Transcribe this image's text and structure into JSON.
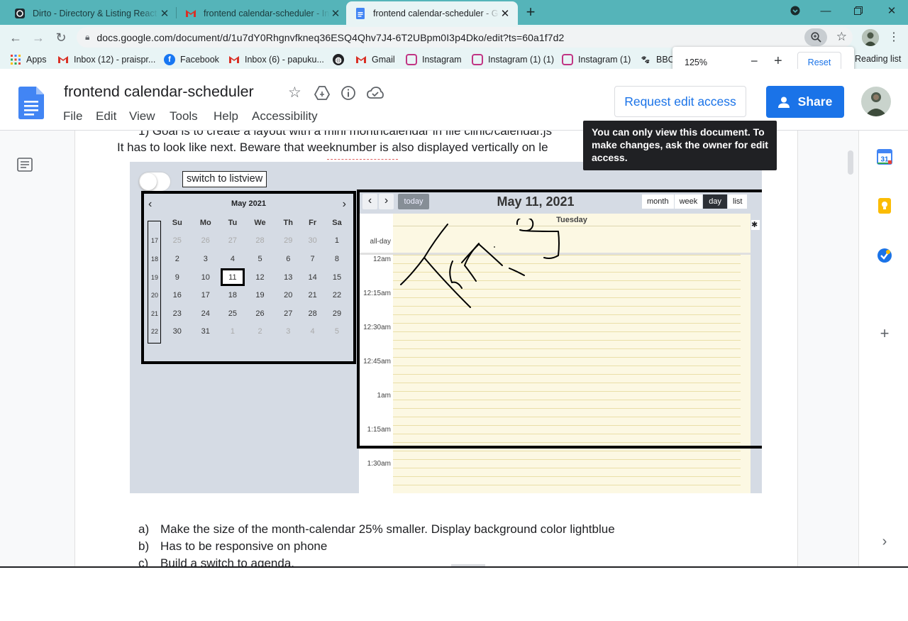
{
  "browser": {
    "tabs": [
      {
        "title": "Dirto - Directory & Listing React",
        "icon": "dirto-favicon"
      },
      {
        "title": "frontend calendar-scheduler - Inb",
        "icon": "gmail-icon"
      },
      {
        "title": "frontend calendar-scheduler - Go",
        "icon": "google-docs-icon",
        "active": true
      }
    ],
    "new_tab": "+",
    "url": "docs.google.com/document/d/1u7dY0Rhgnvfkneq36ESQ4Qhv7J4-6T2UBpm0I3p4Dko/edit?ts=60a1f7d2",
    "bookmarks": [
      {
        "label": "Apps",
        "icon": "apps-grid-icon"
      },
      {
        "label": "Inbox (12) - praispr...",
        "icon": "gmail-icon"
      },
      {
        "label": "Facebook",
        "icon": "facebook-icon"
      },
      {
        "label": "Inbox (6) - papuku...",
        "icon": "gmail-icon"
      },
      {
        "label": "",
        "icon": "globe-icon"
      },
      {
        "label": "Gmail",
        "icon": "gmail-icon"
      },
      {
        "label": "Instagram",
        "icon": "instagram-icon"
      },
      {
        "label": "Instagram (1) (1)",
        "icon": "instagram-icon"
      },
      {
        "label": "Instagram (1)",
        "icon": "instagram-icon"
      },
      {
        "label": "BBC",
        "icon": "paw-icon"
      }
    ],
    "reading_list": "Reading list",
    "zoom": {
      "value": "125%",
      "minus": "−",
      "plus": "+",
      "reset": "Reset"
    }
  },
  "docs": {
    "title": "frontend calendar-scheduler",
    "menu": [
      "File",
      "Edit",
      "View",
      "Tools",
      "Help",
      "Accessibility"
    ],
    "request_edit": "Request edit access",
    "share": "Share",
    "tooltip": "You can only view this document. To make changes, ask the owner for edit access.",
    "body": {
      "line1_partial": "1)   Goal is to create a layout with a mini monthcalendar in file clinic/calendar.js",
      "line2": "It has to look like next. Beware that weeknumber is also displayed vertically on le",
      "items": [
        {
          "marker": "a)",
          "text": "Make the size of the month-calendar 25% smaller. Display background color lightblue"
        },
        {
          "marker": "b)",
          "text": "Has to be responsive on phone"
        },
        {
          "marker": "c)",
          "text": "Build a  switch to agenda."
        }
      ]
    },
    "image": {
      "switch_label": "switch to listview",
      "mini_calendar": {
        "prev": "‹",
        "next": "›",
        "month": "May 2021",
        "weekdays": [
          "Su",
          "Mo",
          "Tu",
          "We",
          "Th",
          "Fr",
          "Sa"
        ],
        "weeks": [
          {
            "no": "17",
            "days": [
              "25",
              "26",
              "27",
              "28",
              "29",
              "30",
              "1"
            ],
            "muted": [
              true,
              true,
              true,
              true,
              true,
              true,
              false
            ]
          },
          {
            "no": "18",
            "days": [
              "2",
              "3",
              "4",
              "5",
              "6",
              "7",
              "8"
            ],
            "muted": [
              false,
              false,
              false,
              false,
              false,
              false,
              false
            ]
          },
          {
            "no": "19",
            "days": [
              "9",
              "10",
              "11",
              "12",
              "13",
              "14",
              "15"
            ],
            "muted": [
              false,
              false,
              false,
              false,
              false,
              false,
              false
            ]
          },
          {
            "no": "20",
            "days": [
              "16",
              "17",
              "18",
              "19",
              "20",
              "21",
              "22"
            ],
            "muted": [
              false,
              false,
              false,
              false,
              false,
              false,
              false
            ]
          },
          {
            "no": "21",
            "days": [
              "23",
              "24",
              "25",
              "26",
              "27",
              "28",
              "29"
            ],
            "muted": [
              false,
              false,
              false,
              false,
              false,
              false,
              false
            ]
          },
          {
            "no": "22",
            "days": [
              "30",
              "31",
              "1",
              "2",
              "3",
              "4",
              "5"
            ],
            "muted": [
              false,
              false,
              true,
              true,
              true,
              true,
              true
            ]
          }
        ],
        "selected": "11"
      },
      "day_view": {
        "prev": "‹",
        "next": "›",
        "today": "today",
        "date": "May 11, 2021",
        "views": [
          "month",
          "week",
          "day",
          "list"
        ],
        "active_view": "day",
        "day_header": "Tuesday",
        "allday": "all-day",
        "times": [
          "12am",
          "12:15am",
          "12:30am",
          "12:45am",
          "1am",
          "1:15am",
          "1:30am"
        ],
        "handwriting": "This"
      }
    }
  },
  "colors": {
    "tab_strip": "#55b4b9",
    "toolbar": "#e8f4f5",
    "accent": "#1a73e8",
    "calendar_bg": "#d5dbe4",
    "slot_bg": "#fcf8e3"
  }
}
